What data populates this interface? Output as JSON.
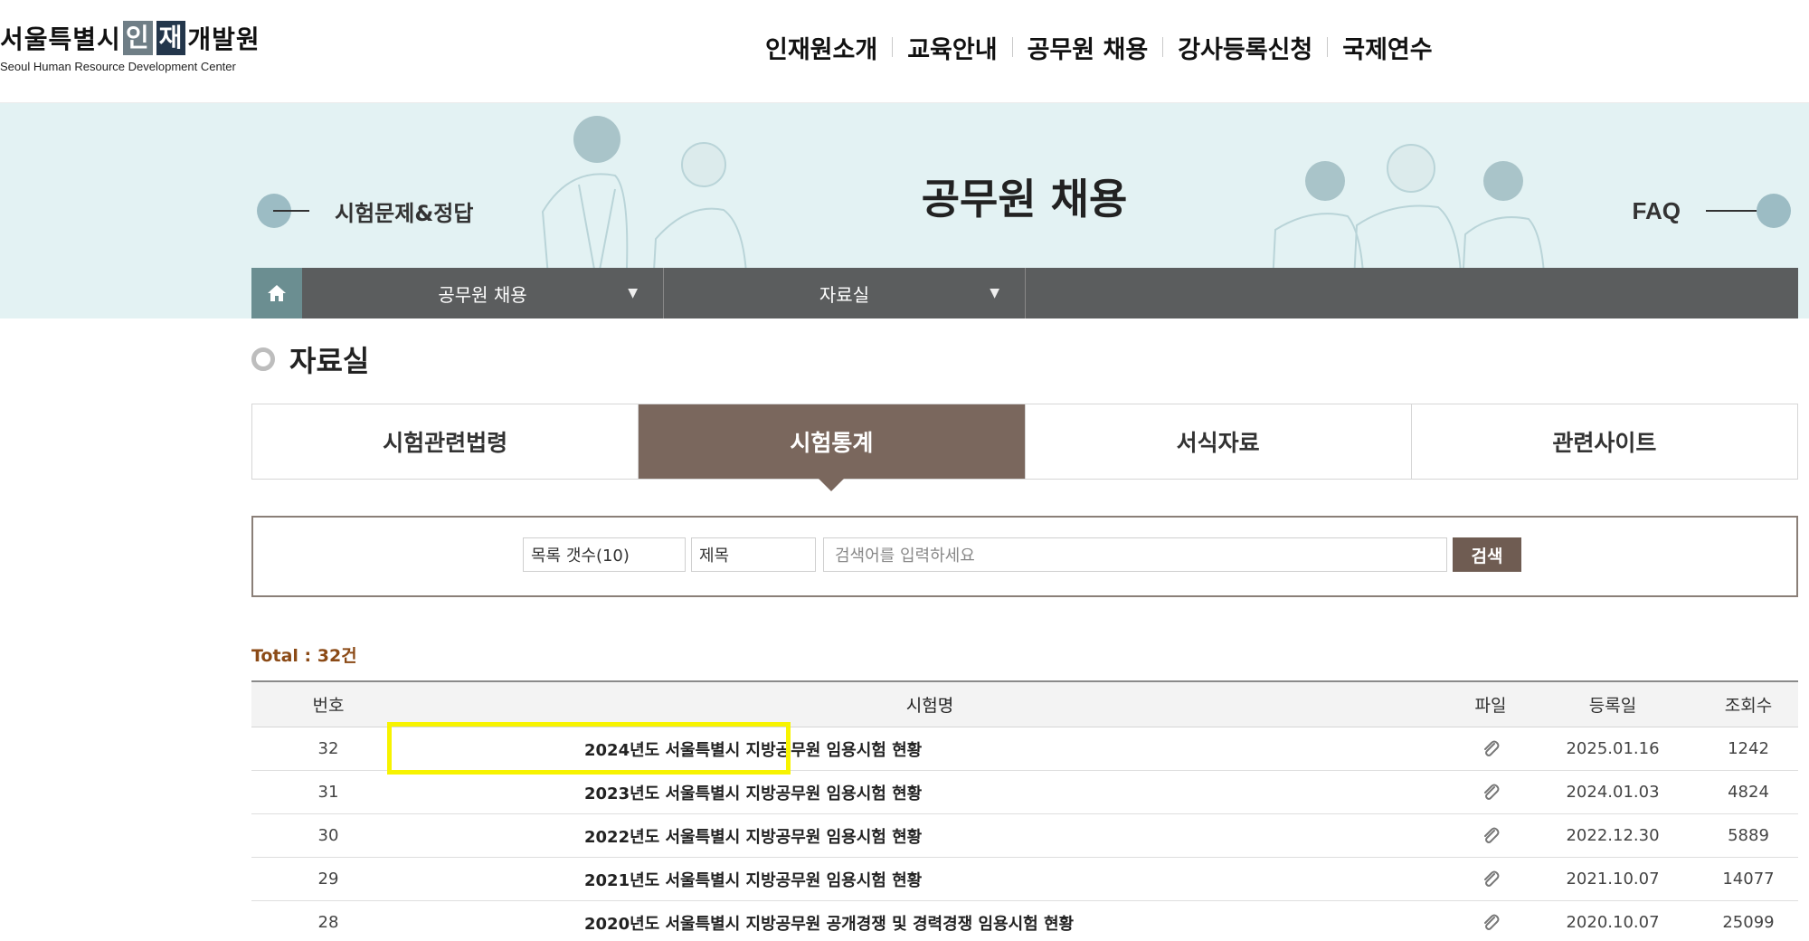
{
  "header": {
    "logo_kr_1": "서울특별시",
    "logo_kr_box1": "인",
    "logo_kr_box2": "재",
    "logo_kr_2": "개발원",
    "logo_en": "Seoul Human Resource Development Center",
    "nav": [
      "인재원소개",
      "교육안내",
      "공무원 채용",
      "강사등록신청",
      "국제연수"
    ]
  },
  "banner": {
    "title": "공무원 채용",
    "prev_label": "시험문제&정답",
    "next_label": "FAQ"
  },
  "breadcrumb": {
    "home_icon": "home-icon",
    "level1": "공무원 채용",
    "level2": "자료실"
  },
  "page": {
    "title": "자료실",
    "tabs": [
      {
        "label": "시험관련법령",
        "active": false
      },
      {
        "label": "시험통계",
        "active": true
      },
      {
        "label": "서식자료",
        "active": false
      },
      {
        "label": "관련사이트",
        "active": false
      }
    ]
  },
  "search": {
    "count_select": "목록 갯수(10)",
    "field_select": "제목",
    "placeholder": "검색어를 입력하세요",
    "button": "검색"
  },
  "board": {
    "total": "Total : 32건",
    "headers": {
      "no": "번호",
      "title": "시험명",
      "file": "파일",
      "date": "등록일",
      "views": "조회수"
    },
    "rows": [
      {
        "no": "32",
        "title": "2024년도 서울특별시 지방공무원 임용시험 현황",
        "date": "2025.01.16",
        "views": "1242"
      },
      {
        "no": "31",
        "title": "2023년도 서울특별시 지방공무원 임용시험 현황",
        "date": "2024.01.03",
        "views": "4824"
      },
      {
        "no": "30",
        "title": "2022년도 서울특별시 지방공무원 임용시험 현황",
        "date": "2022.12.30",
        "views": "5889"
      },
      {
        "no": "29",
        "title": "2021년도 서울특별시 지방공무원 임용시험 현황",
        "date": "2021.10.07",
        "views": "14077"
      },
      {
        "no": "28",
        "title": "2020년도 서울특별시 지방공무원 공개경쟁 및 경력경쟁 임용시험 현황",
        "date": "2020.10.07",
        "views": "25099"
      }
    ]
  },
  "colors": {
    "banner_bg": "#e3f2f3",
    "active_tab": "#7a675d",
    "highlight": "#f7f300",
    "total_text": "#8b4a16"
  }
}
